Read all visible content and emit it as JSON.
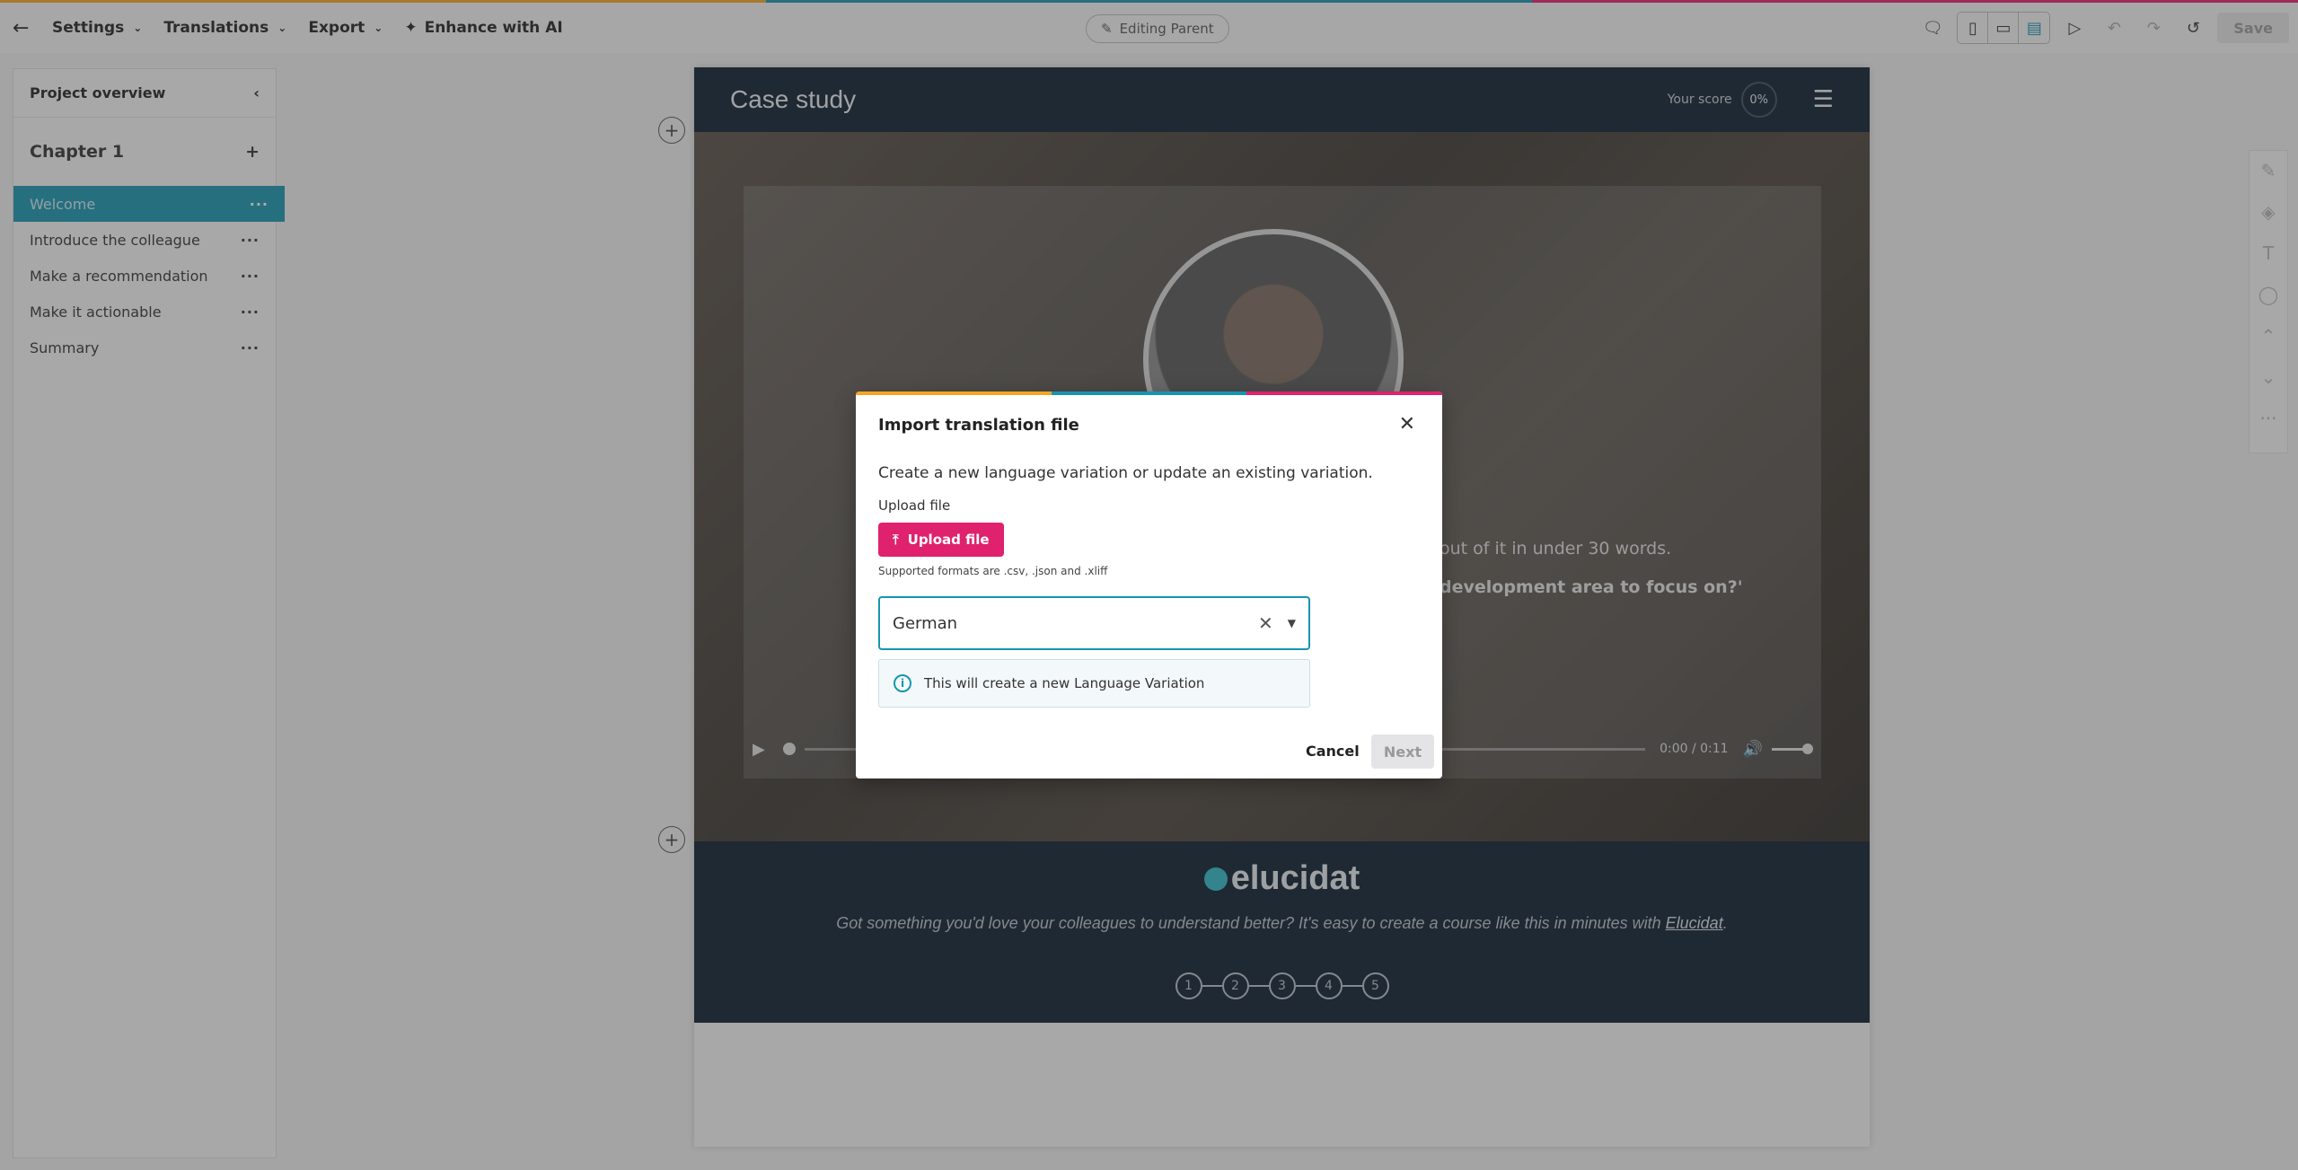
{
  "colors": {
    "accent": "#1795b0",
    "brand_pink": "#e0216e",
    "strip": [
      "#f5a623",
      "#1795b0",
      "#e0216e"
    ],
    "course_dark": "#0c1c2e"
  },
  "toolbar": {
    "settings": "Settings",
    "translations": "Translations",
    "export": "Export",
    "enhance": "Enhance with AI",
    "editing": "Editing Parent",
    "save": "Save",
    "icons": [
      "back-arrow-icon",
      "comments-icon",
      "mobile-icon",
      "tablet-icon",
      "desktop-icon",
      "preview-icon",
      "undo-icon",
      "redo-icon",
      "history-icon"
    ]
  },
  "sidebar": {
    "title": "Project overview",
    "chapter": "Chapter 1",
    "items": [
      {
        "label": "Welcome"
      },
      {
        "label": "Introduce the colleague"
      },
      {
        "label": "Make a recommendation"
      },
      {
        "label": "Make it actionable"
      },
      {
        "label": "Summary"
      }
    ]
  },
  "course": {
    "title": "Case study",
    "score_label": "Your score",
    "score_value": "0%",
    "hero_text1": "out of it in under 30 words.",
    "hero_text2": "development area to focus on?'",
    "time": "0:00 / 0:11",
    "logo": "elucidat",
    "footer_text": "Got something you'd love your colleagues to understand better? It's easy to create a course like this in minutes with",
    "footer_link": "Elucidat",
    "steps": [
      "1",
      "2",
      "3",
      "4",
      "5"
    ]
  },
  "modal": {
    "title": "Import translation file",
    "description": "Create a new language variation or update an existing variation.",
    "upload_label": "Upload file",
    "upload_button": "Upload file",
    "formats": "Supported formats are .csv, .json and .xliff",
    "language": "German",
    "info": "This will create a new Language Variation",
    "cancel": "Cancel",
    "next": "Next"
  }
}
